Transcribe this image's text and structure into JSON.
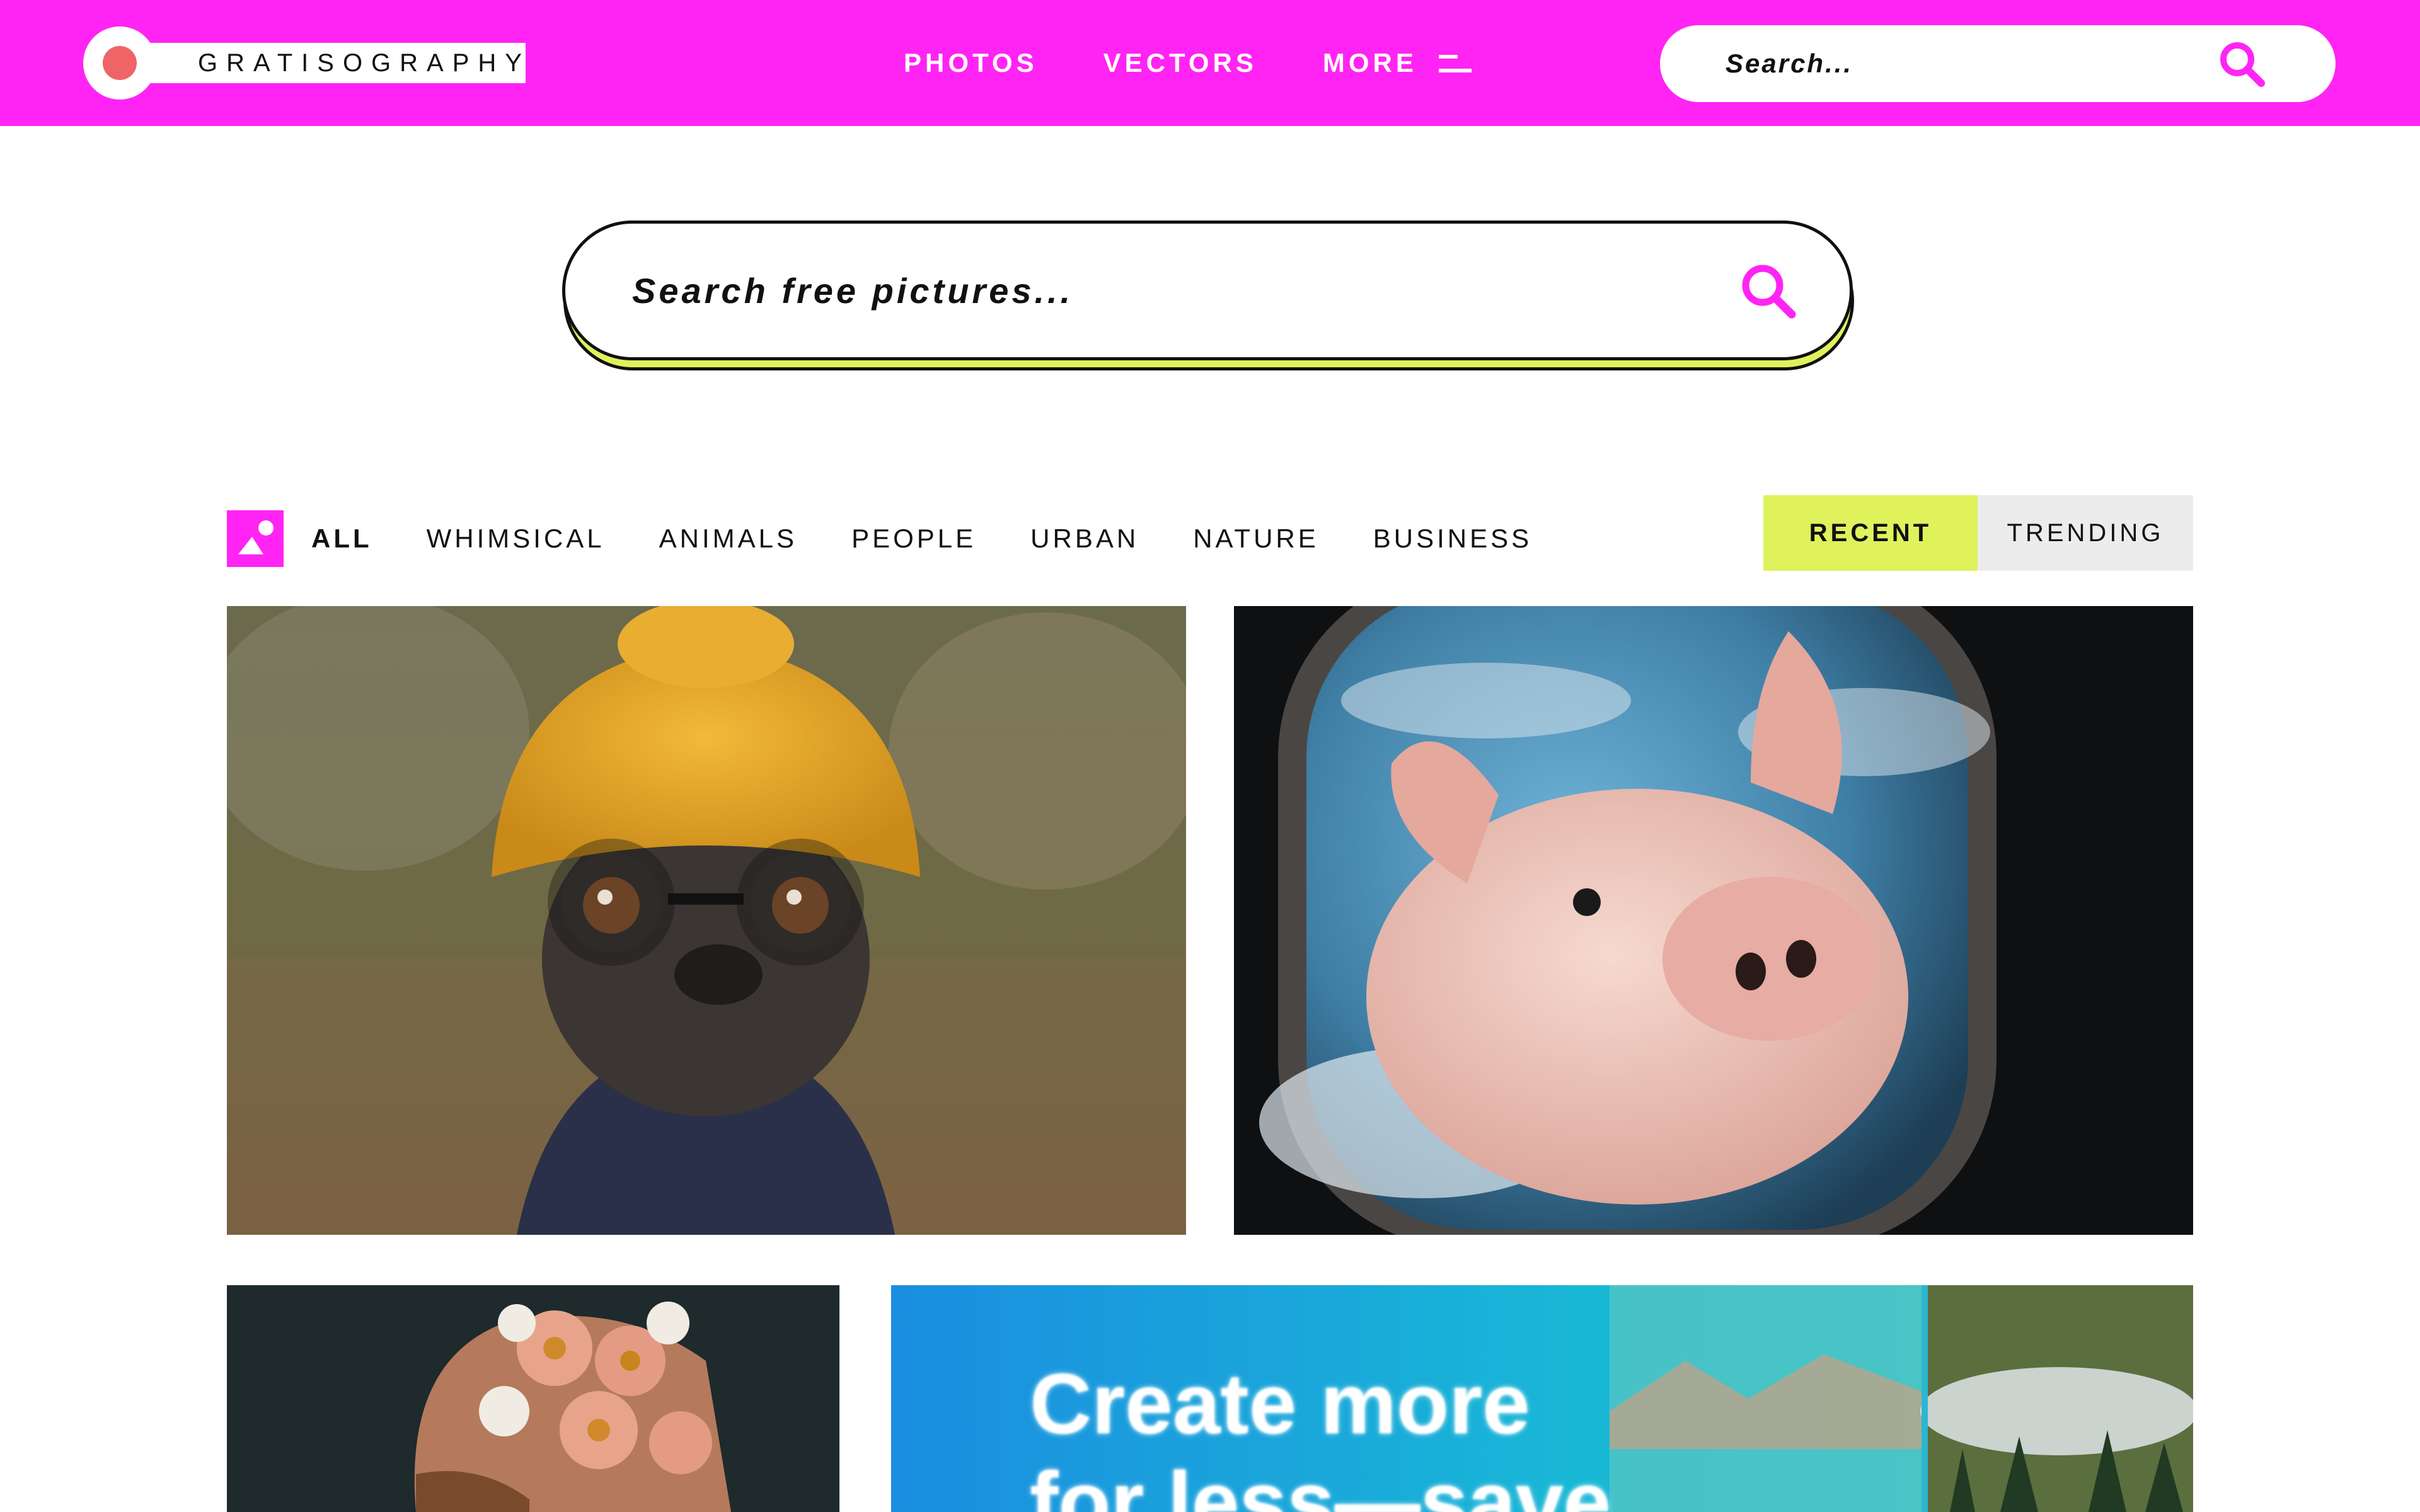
{
  "header": {
    "brand": "GRATISOGRAPHY",
    "nav": {
      "photos": "PHOTOS",
      "vectors": "VECTORS",
      "more": "MORE"
    },
    "search_placeholder": "Search..."
  },
  "hero_search": {
    "placeholder": "Search free pictures..."
  },
  "filters": {
    "categories": [
      "ALL",
      "WHIMSICAL",
      "ANIMALS",
      "PEOPLE",
      "URBAN",
      "NATURE",
      "BUSINESS"
    ],
    "active_category": "ALL",
    "sort": {
      "recent": "RECENT",
      "trending": "TRENDING",
      "active": "RECENT"
    }
  },
  "promo": {
    "line1": "Create more",
    "line2": "for less—save"
  },
  "colors": {
    "brand_pink": "#ff24f4",
    "accent_lime": "#dff25c",
    "logo_dot": "#ef6466"
  },
  "icons": {
    "search": "magnifier-icon",
    "menu": "hamburger-icon",
    "category": "image-icon"
  }
}
